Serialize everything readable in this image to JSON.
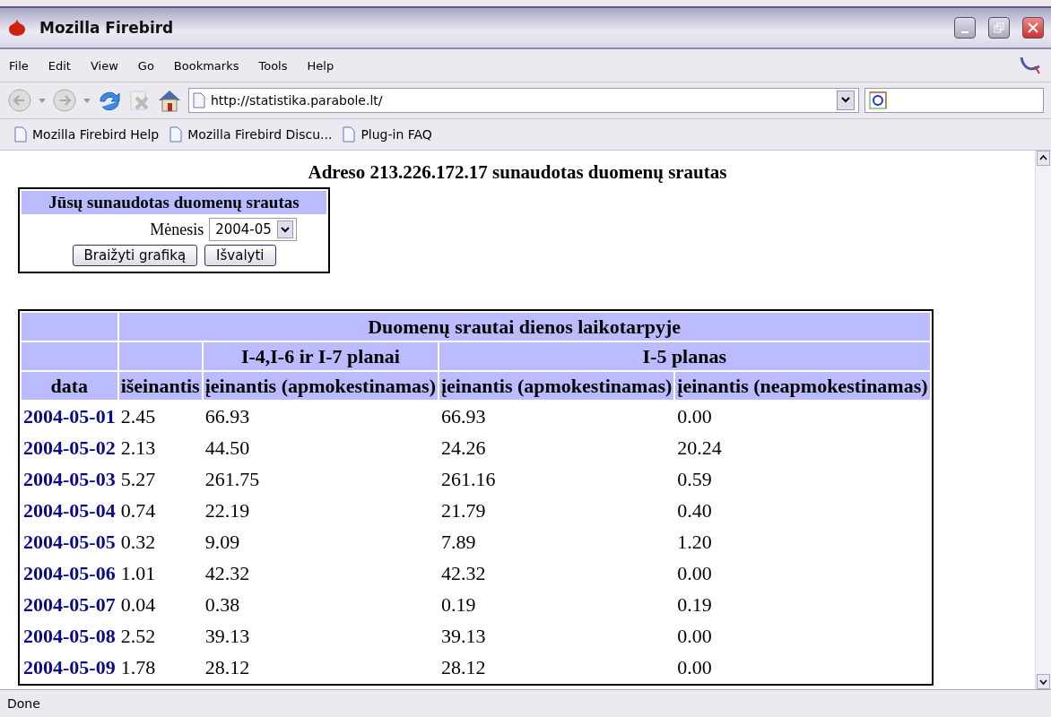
{
  "window": {
    "title": "Mozilla Firebird"
  },
  "menu": [
    "File",
    "Edit",
    "View",
    "Go",
    "Bookmarks",
    "Tools",
    "Help"
  ],
  "address": {
    "value": "http://statistika.parabole.lt/"
  },
  "bookmarks": [
    "Mozilla Firebird Help",
    "Mozilla Firebird Discu...",
    "Plug-in FAQ"
  ],
  "page": {
    "heading": "Adreso 213.226.172.17 sunaudotas duomenų srautas",
    "form": {
      "title": "Jūsų sunaudotas duomenų srautas",
      "month_label": "Mėnesis",
      "month_value": "2004-05",
      "buttons": [
        "Braižyti grafiką",
        "Išvalyti"
      ]
    },
    "table": {
      "group_header": "Duomenų srautai dienos laikotarpyje",
      "plans": [
        "I-4,I-6 ir I-7 planai",
        "I-5 planas"
      ],
      "columns": [
        "data",
        "išeinantis",
        "įeinantis (apmokestinamas)",
        "įeinantis (apmokestinamas)",
        "įeinantis (neapmokestinamas)"
      ],
      "rows": [
        [
          "2004-05-01",
          "2.45",
          "66.93",
          "66.93",
          "0.00"
        ],
        [
          "2004-05-02",
          "2.13",
          "44.50",
          "24.26",
          "20.24"
        ],
        [
          "2004-05-03",
          "5.27",
          "261.75",
          "261.16",
          "0.59"
        ],
        [
          "2004-05-04",
          "0.74",
          "22.19",
          "21.79",
          "0.40"
        ],
        [
          "2004-05-05",
          "0.32",
          "9.09",
          "7.89",
          "1.20"
        ],
        [
          "2004-05-06",
          "1.01",
          "42.32",
          "42.32",
          "0.00"
        ],
        [
          "2004-05-07",
          "0.04",
          "0.38",
          "0.19",
          "0.19"
        ],
        [
          "2004-05-08",
          "2.52",
          "39.13",
          "39.13",
          "0.00"
        ],
        [
          "2004-05-09",
          "1.78",
          "28.12",
          "28.12",
          "0.00"
        ]
      ]
    }
  },
  "status_bar": {
    "text": "Done"
  }
}
